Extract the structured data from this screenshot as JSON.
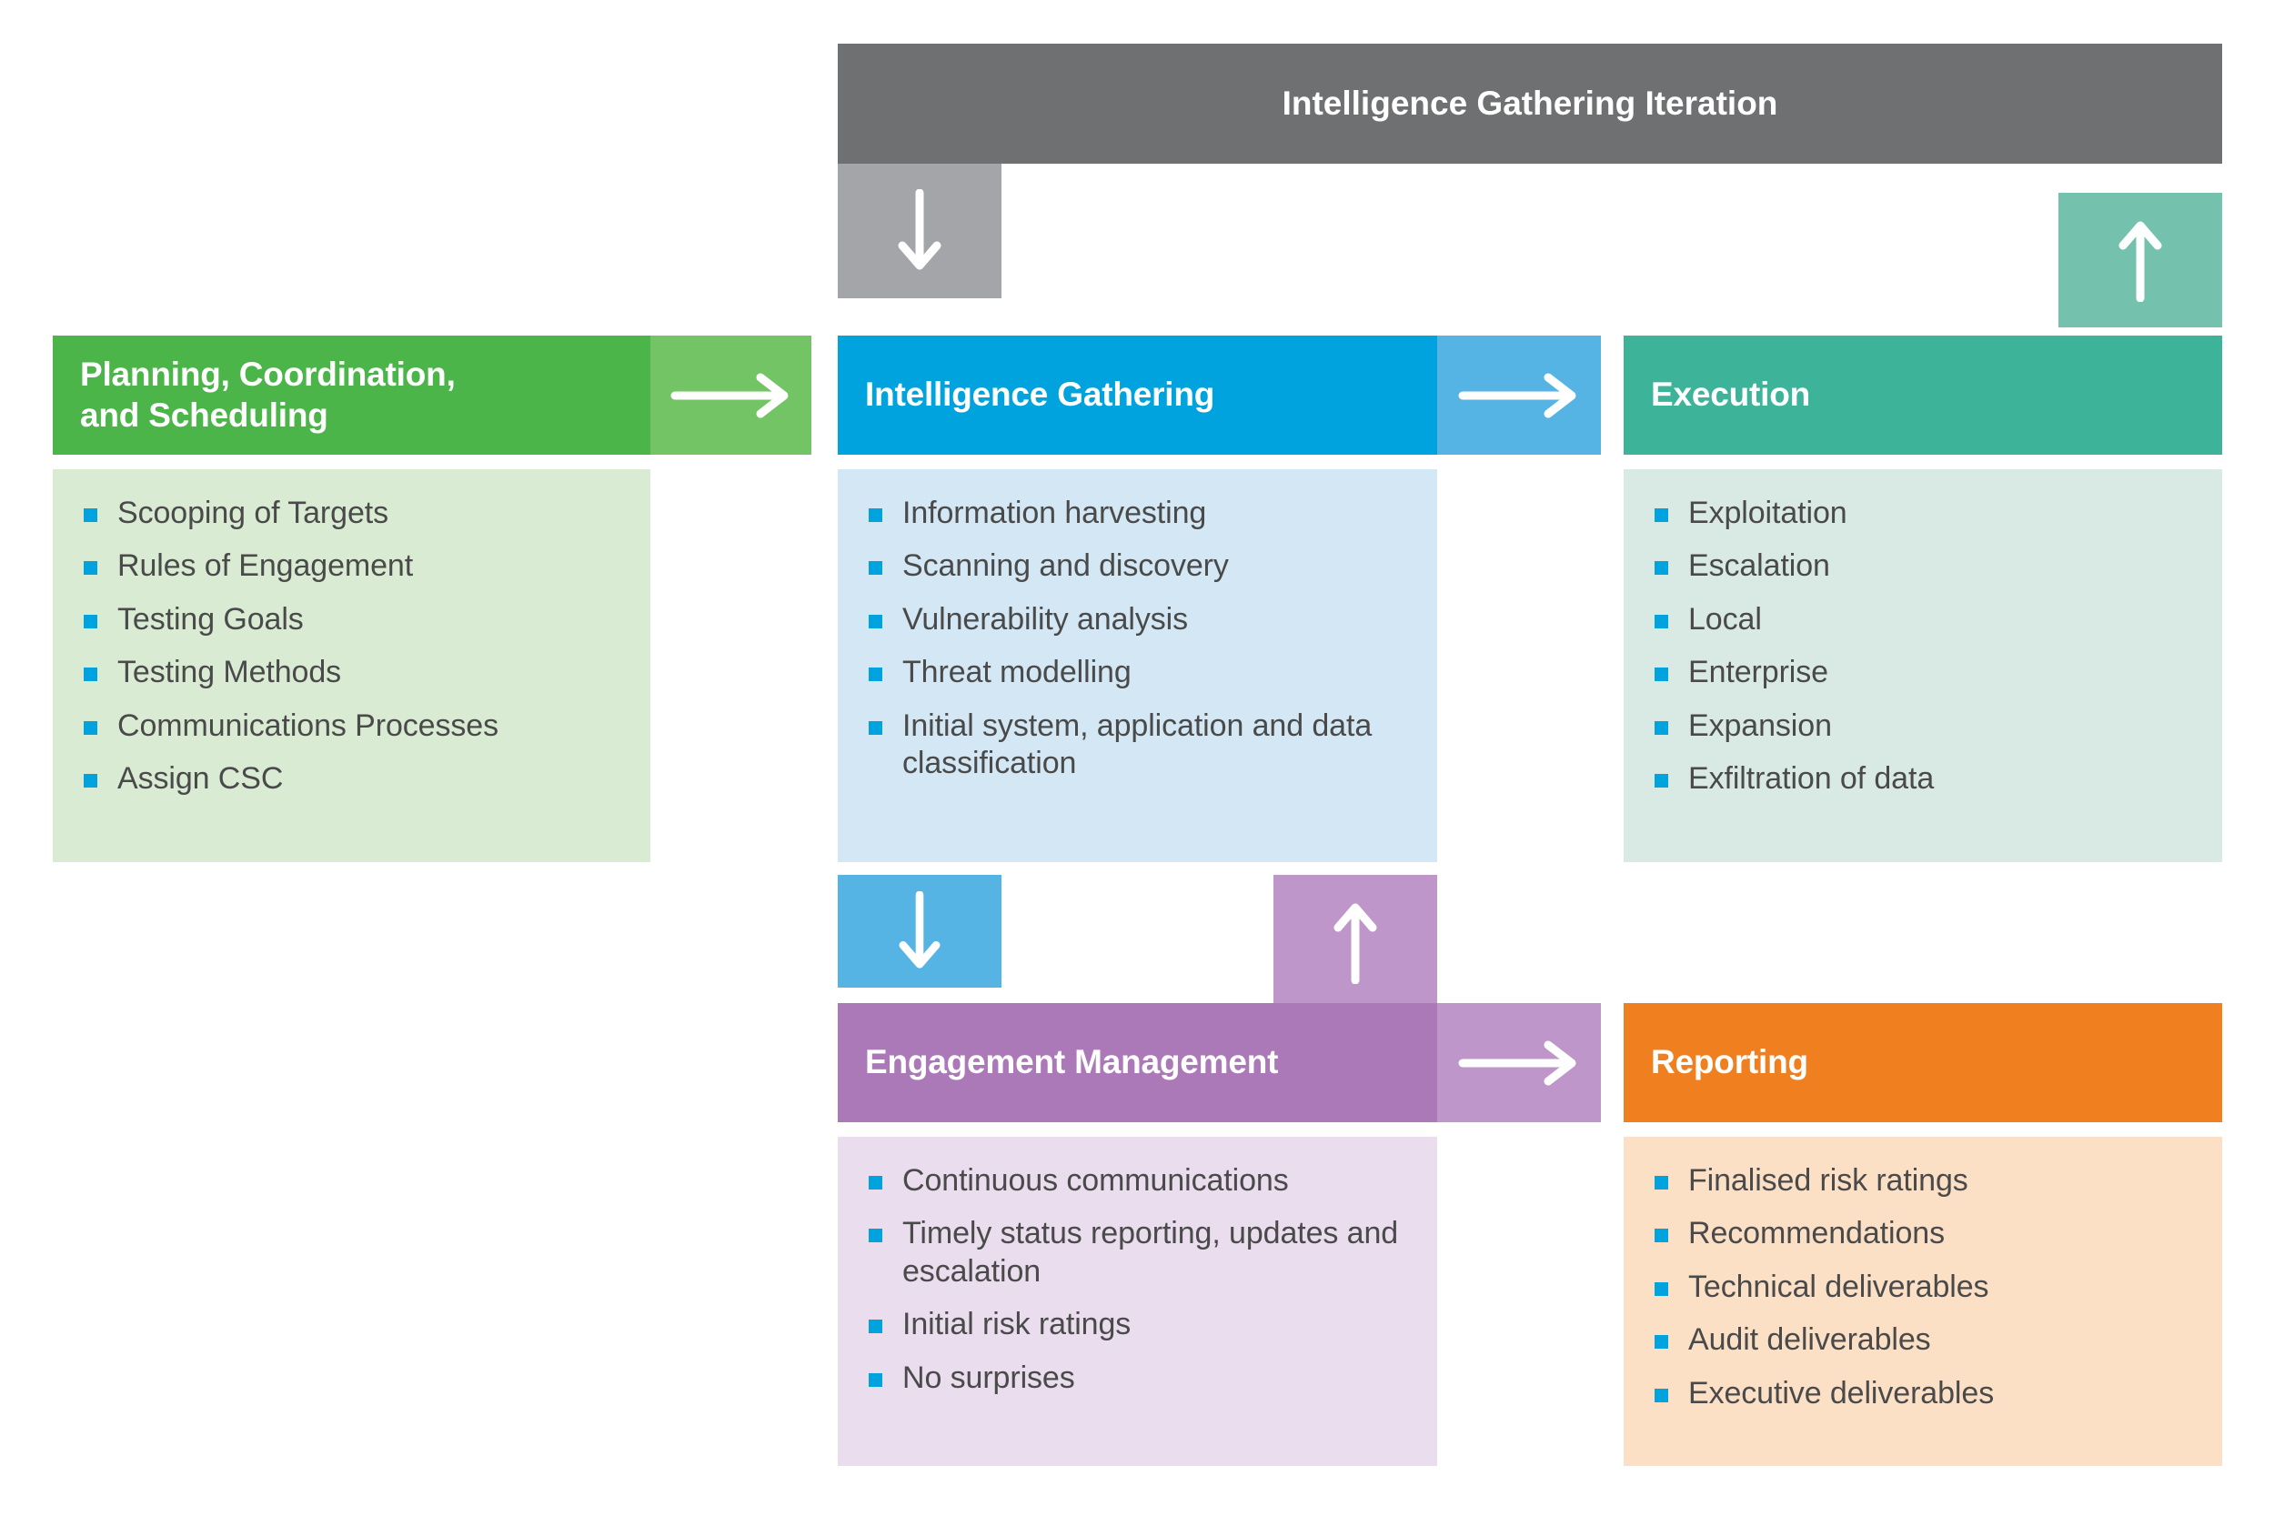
{
  "diagram": {
    "title": "Intelligence Gathering Iteration",
    "colors": {
      "grey_banner": "#6f7072",
      "grey_arrow": "#a3a5a8",
      "green_header": "#4cb549",
      "green_arrow": "#72c464",
      "green_body": "#d9ecd3",
      "blue_header": "#00a3dd",
      "blue_arrow": "#55b4e4",
      "blue_body": "#d3e7f4",
      "teal_header": "#3db39a",
      "teal_arrow": "#74c2ae",
      "teal_body": "#d9eae4",
      "purple_header": "#ab79b8",
      "purple_arrow": "#bf96c9",
      "purple_body": "#e9ddee",
      "orange_header": "#ef7f1f",
      "orange_body": "#fce0c6",
      "bullet": "#00a3dd",
      "body_text": "#4a4a4a",
      "header_text": "#ffffff"
    },
    "phases": [
      {
        "id": "planning",
        "title": "Planning, Coordination,\nand Scheduling",
        "arrow": "arrow-right",
        "items": [
          "Scooping of Targets",
          "Rules of Engagement",
          "Testing Goals",
          "Testing Methods",
          "Communications Processes",
          "Assign CSC"
        ]
      },
      {
        "id": "intelligence-gathering",
        "title": "Intelligence Gathering",
        "arrow": "arrow-right",
        "items": [
          "Information harvesting",
          "Scanning and discovery",
          "Vulnerability analysis",
          "Threat modelling",
          "Initial system, application and data classification"
        ]
      },
      {
        "id": "execution",
        "title": "Execution",
        "arrow": "arrow-up",
        "items": [
          "Exploitation",
          "Escalation",
          "Local",
          "Enterprise",
          "Expansion",
          "Exfiltration of data"
        ]
      },
      {
        "id": "engagement-management",
        "title": "Engagement Management",
        "arrow": "arrow-right",
        "items": [
          "Continuous communications",
          "Timely status reporting, updates and escalation",
          "Initial risk ratings",
          "No surprises"
        ]
      },
      {
        "id": "reporting",
        "title": "Reporting",
        "arrow": "none",
        "items": [
          "Finalised risk ratings",
          "Recommendations",
          "Technical deliverables",
          "Audit deliverables",
          "Executive deliverables"
        ]
      }
    ],
    "connectors": [
      {
        "id": "grey-down",
        "direction": "down"
      },
      {
        "id": "teal-up",
        "direction": "up"
      },
      {
        "id": "blue-down",
        "direction": "down"
      },
      {
        "id": "purple-up",
        "direction": "up"
      }
    ]
  }
}
